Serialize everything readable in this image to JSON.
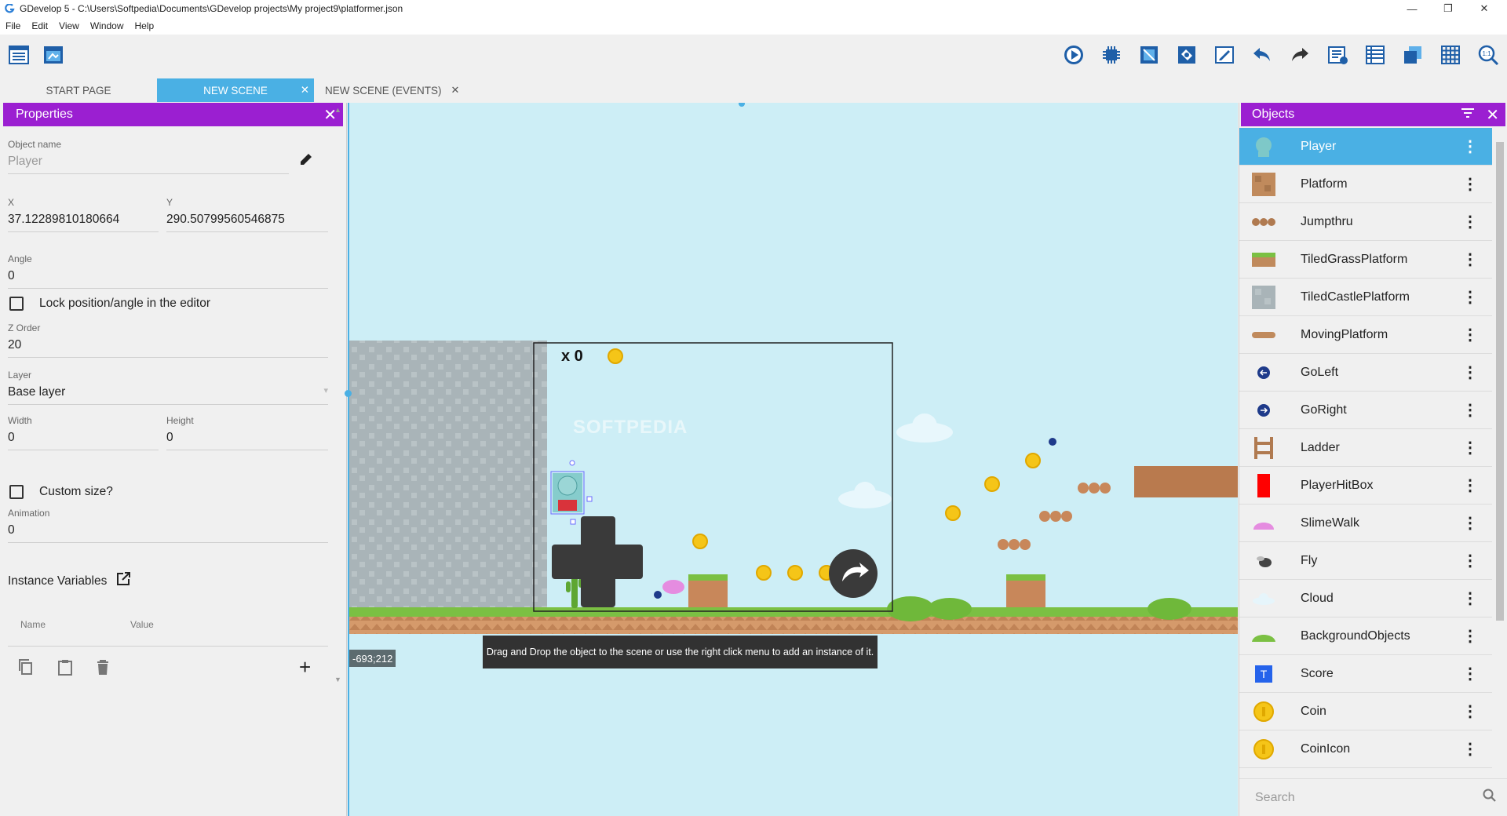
{
  "window": {
    "title": "GDevelop 5 - C:\\Users\\Softpedia\\Documents\\GDevelop projects\\My project9\\platformer.json"
  },
  "menu": [
    "File",
    "Edit",
    "View",
    "Window",
    "Help"
  ],
  "tabs": [
    {
      "label": "START PAGE"
    },
    {
      "label": "NEW SCENE"
    },
    {
      "label": "NEW SCENE (EVENTS)"
    }
  ],
  "properties": {
    "title": "Properties",
    "object_name_label": "Object name",
    "object_name": "Player",
    "x_label": "X",
    "x": "37.12289810180664",
    "y_label": "Y",
    "y": "290.50799560546875",
    "angle_label": "Angle",
    "angle": "0",
    "lock_label": "Lock position/angle in the editor",
    "zorder_label": "Z Order",
    "zorder": "20",
    "layer_label": "Layer",
    "layer": "Base layer",
    "width_label": "Width",
    "width": "0",
    "height_label": "Height",
    "height": "0",
    "custom_size_label": "Custom size?",
    "animation_label": "Animation",
    "animation": "0",
    "instance_vars_label": "Instance Variables",
    "col_name": "Name",
    "col_value": "Value"
  },
  "scene": {
    "coin_counter": "x 0",
    "watermark": "SOFTPEDIA",
    "hint": "Drag and Drop the object to the scene or use the right click menu to add an instance of it.",
    "cursor_coords": "-693;212"
  },
  "objects": {
    "title": "Objects",
    "search_placeholder": "Search",
    "items": [
      {
        "name": "Player",
        "color": "#7ec8c8"
      },
      {
        "name": "Platform",
        "color": "#c08a5c"
      },
      {
        "name": "Jumpthru",
        "color": "#b07a50"
      },
      {
        "name": "TiledGrassPlatform",
        "color": "#7bc043"
      },
      {
        "name": "TiledCastlePlatform",
        "color": "#a9b4b8"
      },
      {
        "name": "MovingPlatform",
        "color": "#c08a5c"
      },
      {
        "name": "GoLeft",
        "color": "#1e3a8a"
      },
      {
        "name": "GoRight",
        "color": "#1e3a8a"
      },
      {
        "name": "Ladder",
        "color": "#b07a50"
      },
      {
        "name": "PlayerHitBox",
        "color": "#ff0000"
      },
      {
        "name": "SlimeWalk",
        "color": "#e58ce0"
      },
      {
        "name": "Fly",
        "color": "#444444"
      },
      {
        "name": "Cloud",
        "color": "#e6f5fb"
      },
      {
        "name": "BackgroundObjects",
        "color": "#7bc043"
      },
      {
        "name": "Score",
        "color": "#2563eb"
      },
      {
        "name": "Coin",
        "color": "#f5c518"
      },
      {
        "name": "CoinIcon",
        "color": "#f5c518"
      }
    ]
  },
  "colors": {
    "accent": "#9b1fd1",
    "selection": "#4ab0e4",
    "sky": "#cdeef6"
  }
}
